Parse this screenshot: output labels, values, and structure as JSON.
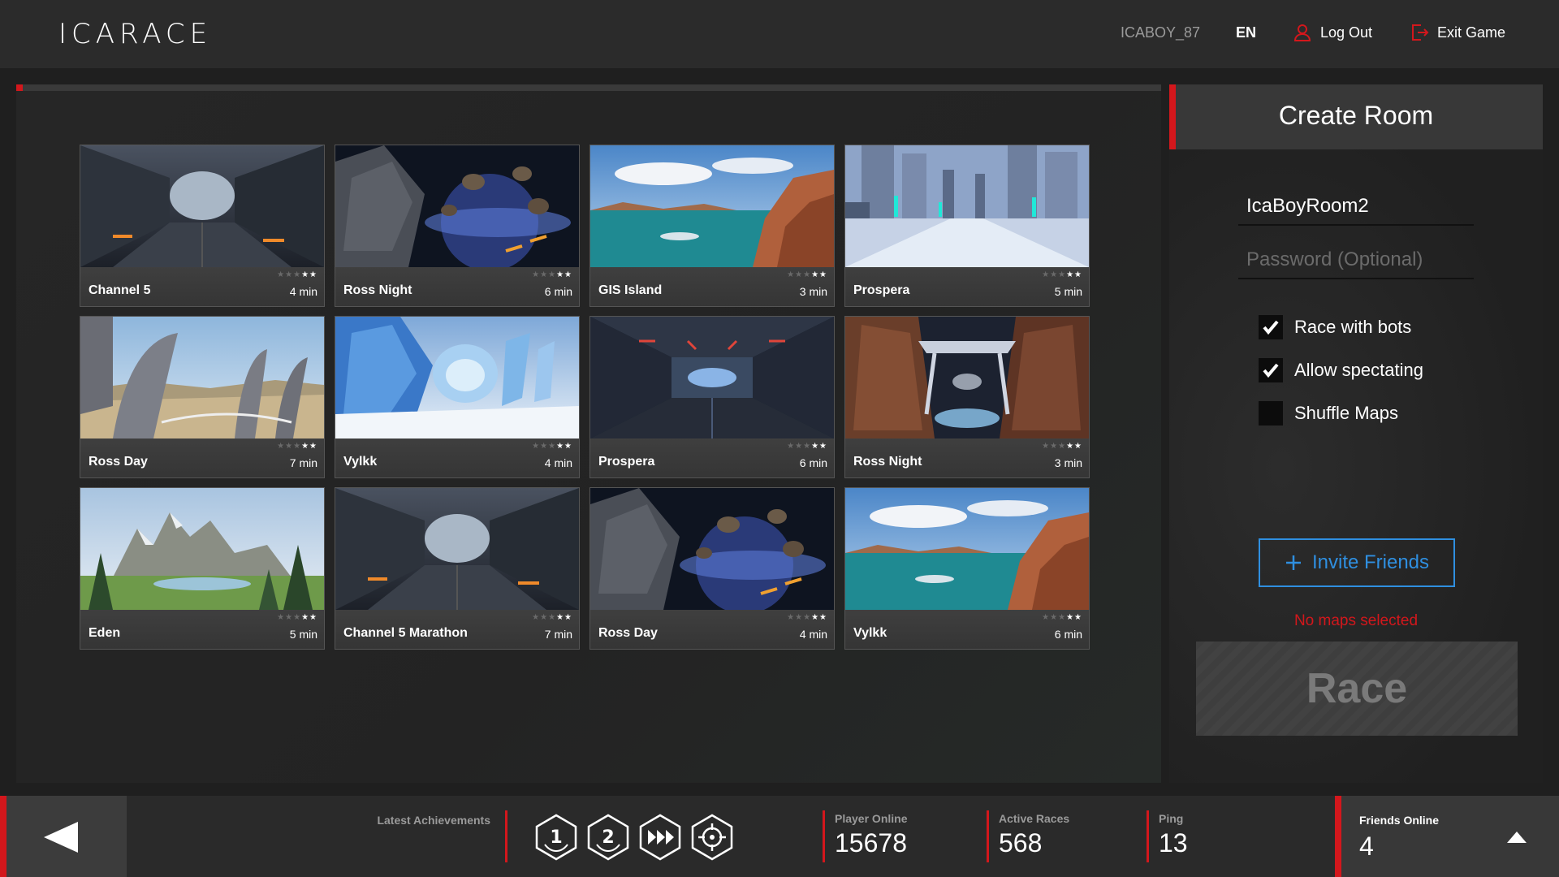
{
  "app": {
    "logo": "ICARACE"
  },
  "topbar": {
    "username": "ICABOY_87",
    "language": "EN",
    "logout_label": "Log Out",
    "exit_label": "Exit Game"
  },
  "maps": [
    {
      "name": "Channel 5",
      "time": "4 min",
      "stars": 2,
      "thumb": "tunnel"
    },
    {
      "name": "Ross Night",
      "time": "6 min",
      "stars": 2,
      "thumb": "asteroids"
    },
    {
      "name": "GIS Island",
      "time": "3 min",
      "stars": 2,
      "thumb": "island"
    },
    {
      "name": "Prospera",
      "time": "5 min",
      "stars": 2,
      "thumb": "city"
    },
    {
      "name": "Ross Day",
      "time": "7 min",
      "stars": 2,
      "thumb": "desert"
    },
    {
      "name": "Vylkk",
      "time": "4 min",
      "stars": 2,
      "thumb": "ice"
    },
    {
      "name": "Prospera",
      "time": "6 min",
      "stars": 2,
      "thumb": "hangar"
    },
    {
      "name": "Ross Night",
      "time": "3 min",
      "stars": 2,
      "thumb": "canyon"
    },
    {
      "name": "Eden",
      "time": "5 min",
      "stars": 2,
      "thumb": "mountains"
    },
    {
      "name": "Channel 5 Marathon",
      "time": "7 min",
      "stars": 2,
      "thumb": "tunnel"
    },
    {
      "name": "Ross Day",
      "time": "4 min",
      "stars": 2,
      "thumb": "asteroids"
    },
    {
      "name": "Vylkk",
      "time": "6 min",
      "stars": 2,
      "thumb": "island"
    }
  ],
  "create_room": {
    "title": "Create Room",
    "room_name_value": "IcaBoyRoom2",
    "password_placeholder": "Password (Optional)",
    "options": [
      {
        "label": "Race with bots",
        "checked": true
      },
      {
        "label": "Allow spectating",
        "checked": true
      },
      {
        "label": "Shuffle Maps",
        "checked": false
      }
    ],
    "invite_label": "Invite Friends",
    "warning": "No maps selected",
    "race_label": "Race"
  },
  "bottombar": {
    "achievements_label": "Latest Achievements",
    "achievements": [
      "first-place-icon",
      "second-place-icon",
      "speed-boost-icon",
      "target-icon"
    ],
    "stats": [
      {
        "label": "Player Online",
        "value": "15678"
      },
      {
        "label": "Active Races",
        "value": "568"
      },
      {
        "label": "Ping",
        "value": "13"
      }
    ],
    "friends_label": "Friends Online",
    "friends_value": "4"
  },
  "colors": {
    "accent_red": "#d3171c",
    "invite_blue": "#2f8fe0"
  }
}
